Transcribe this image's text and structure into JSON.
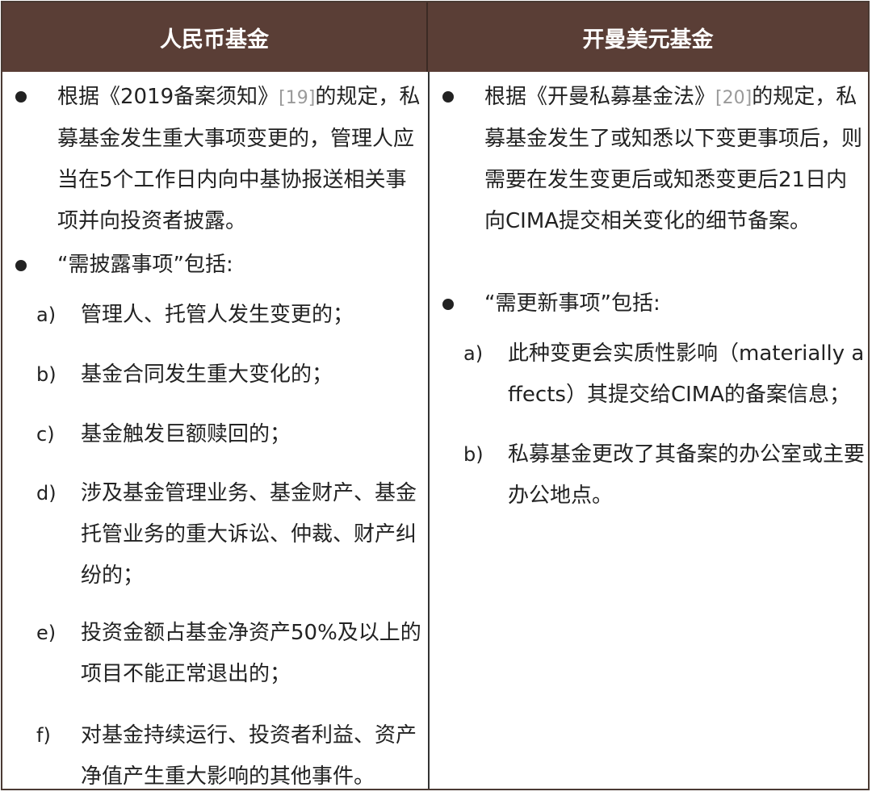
{
  "header": {
    "left": "人民币基金",
    "right": "开曼美元基金"
  },
  "left": {
    "bullet1": {
      "pre": "根据《2019备案须知》",
      "ref": "[19]",
      "post": "的规定，私募基金发生重大事项变更的，管理人应当在5个工作日内向中基协报送相关事项并向投资者披露。"
    },
    "bullet2": "“需披露事项”包括:",
    "items": [
      {
        "label": "a)",
        "text": "管理人、托管人发生变更的；"
      },
      {
        "label": "b)",
        "text": "基金合同发生重大变化的；"
      },
      {
        "label": "c)",
        "text": "基金触发巨额赎回的；"
      },
      {
        "label": "d)",
        "text": "涉及基金管理业务、基金财产、基金托管业务的重大诉讼、仲裁、财产纠纷的；"
      },
      {
        "label": "e)",
        "text": "投资金额占基金净资产50%及以上的项目不能正常退出的；"
      },
      {
        "label": "f)",
        "text": "对基金持续运行、投资者利益、资产净值产生重大影响的其他事件。"
      }
    ]
  },
  "right": {
    "bullet1": {
      "pre": "根据《开曼私募基金法》",
      "ref": "[20]",
      "post": "的规定，私募基金发生了或知悉以下变更事项后，则需要在发生变更后或知悉变更后21日内向CIMA提交相关变化的细节备案。"
    },
    "bullet2": "“需更新事项”包括:",
    "items": [
      {
        "label": "a)",
        "text": "此种变更会实质性影响（materially affects）其提交给CIMA的备案信息；"
      },
      {
        "label": "b)",
        "text": "私募基金更改了其备案的办公室或主要办公地点。"
      }
    ]
  }
}
